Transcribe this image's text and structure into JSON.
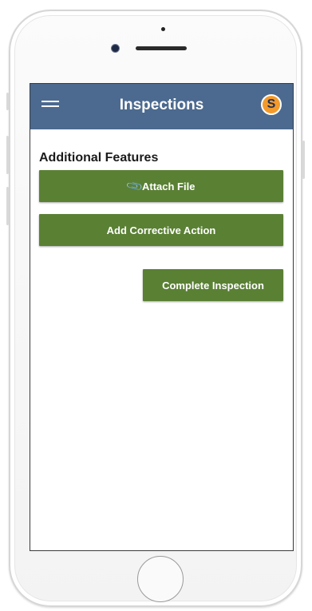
{
  "header": {
    "title": "Inspections",
    "menu_icon": "hamburger-menu-icon",
    "logo_icon": "app-logo-icon",
    "logo_glyph": "S"
  },
  "main": {
    "section_title": "Additional Features",
    "buttons": {
      "attach_file": "Attach File",
      "attach_icon": "paperclip-icon",
      "add_corrective_action": "Add Corrective Action",
      "complete_inspection": "Complete Inspection"
    }
  },
  "colors": {
    "header_bg": "#4c6a8f",
    "button_bg": "#5a8034",
    "logo_accent": "#f39a2b"
  }
}
